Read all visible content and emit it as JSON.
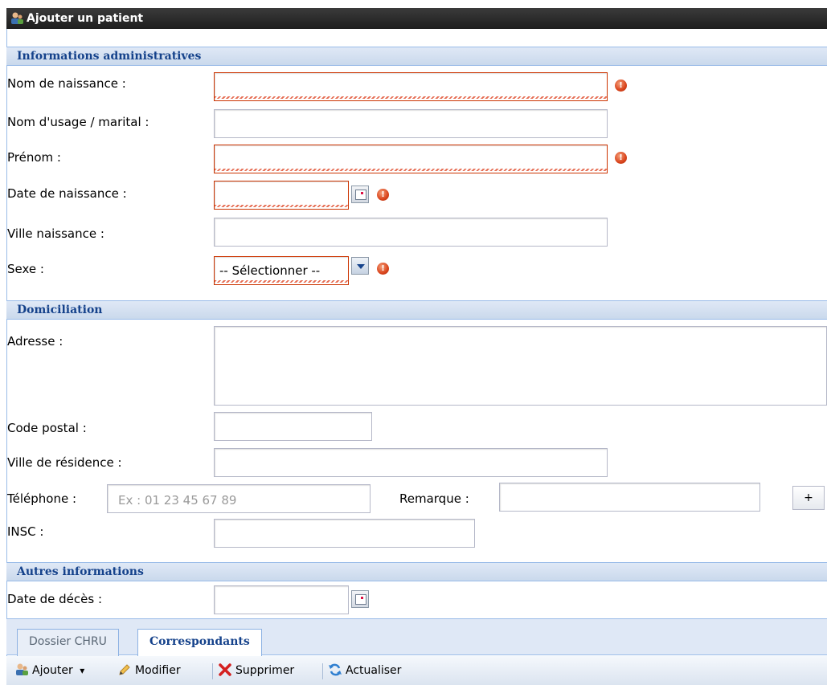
{
  "window": {
    "title": "Ajouter un patient"
  },
  "sections": {
    "admin": "Informations administratives",
    "domicile": "Domiciliation",
    "autres": "Autres informations"
  },
  "fields": {
    "nom_naissance": "Nom de naissance :",
    "nom_usage": "Nom d'usage / marital :",
    "prenom": "Prénom :",
    "date_naissance": "Date de naissance :",
    "ville_naissance": "Ville naissance :",
    "sexe": "Sexe :",
    "sexe_value": "-- Sélectionner --",
    "adresse": "Adresse :",
    "code_postal": "Code postal :",
    "ville_residence": "Ville de résidence :",
    "telephone": "Téléphone :",
    "telephone_placeholder": "Ex : 01 23 45 67 89",
    "remarque": "Remarque :",
    "plus": "+",
    "insc": "INSC :",
    "date_deces": "Date de décès :"
  },
  "tabs": [
    "Dossier CHRU",
    "Correspondants"
  ],
  "toolbar": {
    "ajouter": "Ajouter",
    "modifier": "Modifier",
    "supprimer": "Supprimer",
    "actualiser": "Actualiser"
  },
  "icons": {
    "error": "!",
    "dropdown": "▾"
  },
  "colors": {
    "header_bg": "#dfe8f6",
    "header_text": "#15428b",
    "invalid_border": "#cc3300"
  }
}
